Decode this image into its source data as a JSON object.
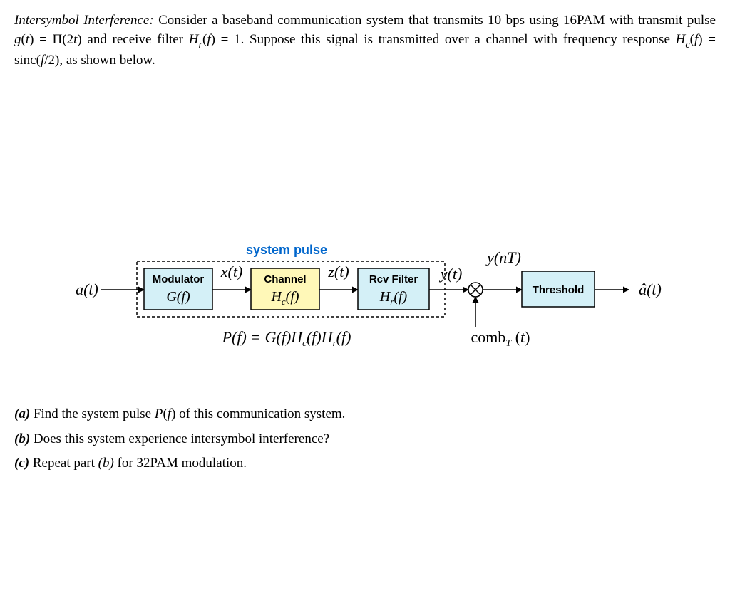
{
  "intro": {
    "title_italic": "Intersymbol Interference:",
    "line1": " Consider a baseband communication system that transmits 10 bps using 16PAM with transmit pulse ",
    "gt": "g(t) = Π(2t)",
    "line2": " and receive filter ",
    "hr": "H",
    "hr_sub": "r",
    "hr_arg": "(f) = 1",
    "line3": ". Suppose this signal is transmitted over a channel with frequency response ",
    "hc": "H",
    "hc_sub": "c",
    "hc_arg": "(f) = sinc(f/2)",
    "line4": ", as shown below."
  },
  "diagram": {
    "system_pulse_label": "system pulse",
    "a_t": "a(t)",
    "modulator": "Modulator",
    "G_f": "G(f)",
    "x_t": "x(t)",
    "channel": "Channel",
    "Hc_f": "H (f)",
    "Hc_sub": "c",
    "z_t": "z(t)",
    "rcv_filter": "Rcv Filter",
    "Hr_f": "H (f)",
    "Hr_sub": "r",
    "y_t": "y(t)",
    "y_nT": "y(nT)",
    "threshold": "Threshold",
    "a_hat_t": "â(t)",
    "comb": "comb  (t)",
    "comb_sub": "T",
    "pf_eq": "P(f) = G(f)H (f)H (f)",
    "pf_c": "c",
    "pf_r": "r"
  },
  "questions": {
    "a": {
      "label": "(a)",
      "text": " Find the system pulse ",
      "pf": "P(f)",
      "text2": " of this communication system."
    },
    "b": {
      "label": "(b)",
      "text": " Does this system experience intersymbol interference?"
    },
    "c": {
      "label": "(c)",
      "text": " Repeat part ",
      "ref": "(b)",
      "text2": " for 32PAM modulation."
    }
  }
}
